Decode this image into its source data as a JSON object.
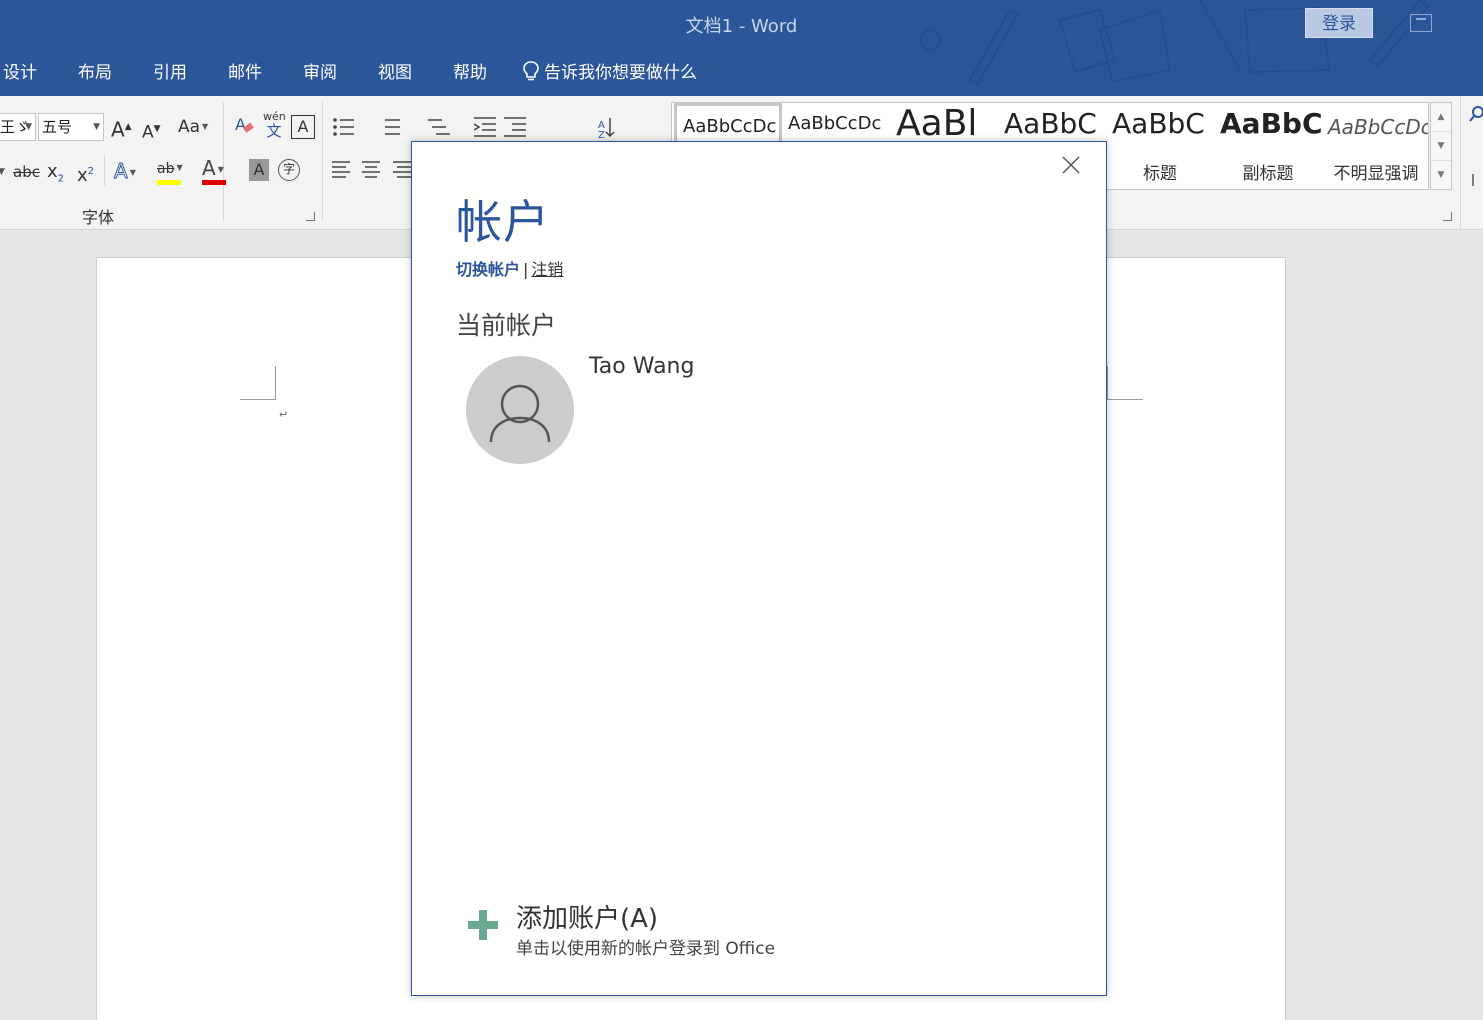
{
  "window": {
    "title": "文档1  -  Word",
    "signin_label": "登录"
  },
  "tabs": [
    "设计",
    "布局",
    "引用",
    "邮件",
    "审阅",
    "视图",
    "帮助"
  ],
  "tell_me": "告诉我你想要做什么",
  "ribbon": {
    "font_name_partial": "王ゞ",
    "font_size": "五号",
    "grow_font": "A",
    "shrink_font": "A",
    "change_case": "Aa",
    "phonetic_top": "wén",
    "phonetic_bottom": "文",
    "char_border": "A",
    "strikethrough": "abc",
    "subscript": "x",
    "superscript": "x",
    "sub_mark": "2",
    "sup_mark": "2",
    "text_effects": "A",
    "highlight": "ab",
    "font_color": "A",
    "char_shading": "A",
    "enclose_char": "字",
    "font_group_label": "字体",
    "highlight_color": "#ffff00",
    "font_color_value": "#e00000"
  },
  "styles": [
    {
      "preview": "AaBbCcDc",
      "name": ""
    },
    {
      "preview": "AaBbCcDc",
      "name": ""
    },
    {
      "preview": "AaBl",
      "name": ""
    },
    {
      "preview": "AaBbC",
      "name": ""
    },
    {
      "preview": "AaBbC",
      "name": "标题"
    },
    {
      "preview": "AaBbC",
      "name": "副标题"
    },
    {
      "preview": "AaBbCcDc",
      "name": "不明显强调"
    }
  ],
  "dialog": {
    "title": "帐户",
    "switch_account": "切换帐户",
    "separator": "|",
    "sign_out": "注销",
    "current_account_label": "当前帐户",
    "user_name": "Tao Wang",
    "add_account_title": "添加账户(A)",
    "add_account_subtitle": "单击以使用新的帐户登录到 Office"
  },
  "colors": {
    "brand": "#2b579a",
    "add_icon": "#6aa88f"
  }
}
